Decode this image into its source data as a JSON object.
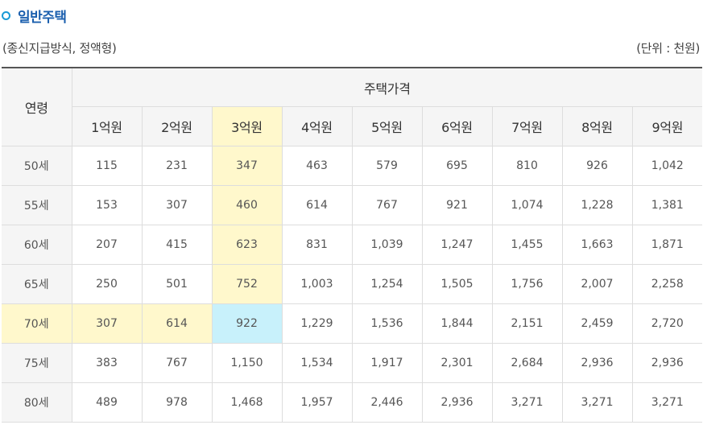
{
  "section": {
    "title": "일반주택",
    "icon": "ring-bullet-icon",
    "icon_color": "#1a9ad6",
    "title_color": "#1b5fae"
  },
  "meta": {
    "method": "(종신지급방식, 정액형)",
    "unit": "(단위 : 천원)"
  },
  "table": {
    "age_header": "연령",
    "group_header": "주택가격",
    "price_headers": [
      "1억원",
      "2억원",
      "3억원",
      "4억원",
      "5억원",
      "6억원",
      "7억원",
      "8억원",
      "9억원"
    ],
    "rows": [
      {
        "age": "50세",
        "values": [
          "115",
          "231",
          "347",
          "463",
          "579",
          "695",
          "810",
          "926",
          "1,042"
        ]
      },
      {
        "age": "55세",
        "values": [
          "153",
          "307",
          "460",
          "614",
          "767",
          "921",
          "1,074",
          "1,228",
          "1,381"
        ]
      },
      {
        "age": "60세",
        "values": [
          "207",
          "415",
          "623",
          "831",
          "1,039",
          "1,247",
          "1,455",
          "1,663",
          "1,871"
        ]
      },
      {
        "age": "65세",
        "values": [
          "250",
          "501",
          "752",
          "1,003",
          "1,254",
          "1,505",
          "1,756",
          "2,007",
          "2,258"
        ]
      },
      {
        "age": "70세",
        "values": [
          "307",
          "614",
          "922",
          "1,229",
          "1,536",
          "1,844",
          "2,151",
          "2,459",
          "2,720"
        ]
      },
      {
        "age": "75세",
        "values": [
          "383",
          "767",
          "1,150",
          "1,534",
          "1,917",
          "2,301",
          "2,684",
          "2,936",
          "2,936"
        ]
      },
      {
        "age": "80세",
        "values": [
          "489",
          "978",
          "1,468",
          "1,957",
          "2,446",
          "2,936",
          "3,271",
          "3,271",
          "3,271"
        ]
      }
    ],
    "highlight": {
      "column_label": "3억원",
      "row_label": "70세",
      "row_color": "#fff8cc",
      "column_color": "#fff8cc",
      "intersection_color": "#c8f1fb"
    }
  }
}
